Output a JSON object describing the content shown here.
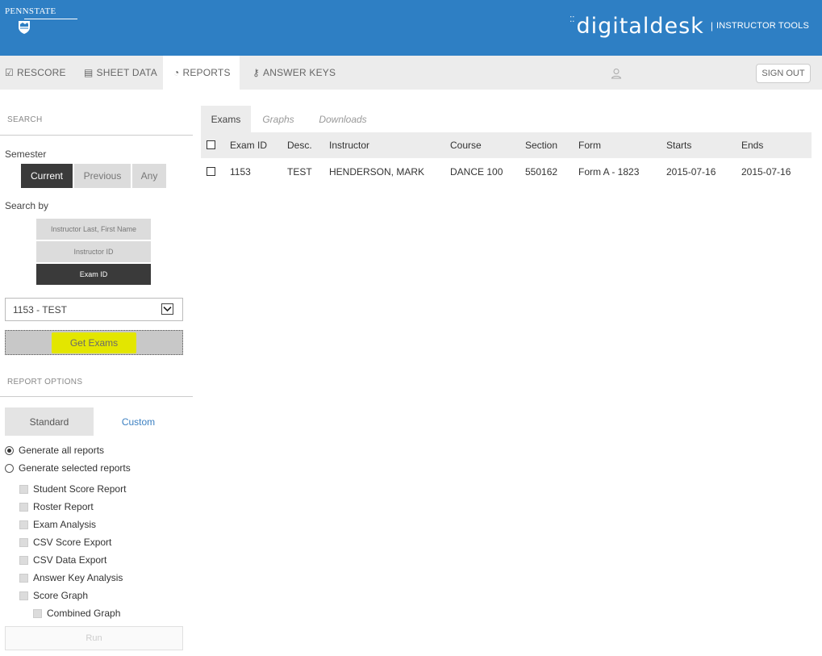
{
  "header": {
    "university": "PENNSTATE",
    "brand_name": "digitaldesk",
    "brand_separator": "|",
    "brand_tools": "INSTRUCTOR TOOLS",
    "color": "#2e7fc4"
  },
  "nav": {
    "items": [
      {
        "label": "RESCORE",
        "icon": "check-square-icon"
      },
      {
        "label": "SHEET DATA",
        "icon": "sheet-icon"
      },
      {
        "label": "REPORTS",
        "icon": "pie-chart-icon",
        "active": true
      },
      {
        "label": "ANSWER KEYS",
        "icon": "key-icon"
      }
    ],
    "signout": "SIGN OUT"
  },
  "sidebar": {
    "search_title": "SEARCH",
    "semester_label": "Semester",
    "semester_options": [
      "Current",
      "Previous",
      "Any"
    ],
    "semester_selected": "Current",
    "search_by_label": "Search by",
    "search_by_options": [
      "Instructor Last, First Name",
      "Instructor ID",
      "Exam ID"
    ],
    "search_by_selected": "Exam ID",
    "exam_select_value": "1153 - TEST",
    "get_exams": "Get Exams",
    "report_options_title": "REPORT OPTIONS",
    "report_tabs": [
      "Standard",
      "Custom"
    ],
    "radios": [
      {
        "label": "Generate all reports",
        "checked": true
      },
      {
        "label": "Generate selected reports",
        "checked": false
      }
    ],
    "reports": [
      "Student Score Report",
      "Roster Report",
      "Exam Analysis",
      "CSV Score Export",
      "CSV Data Export",
      "Answer Key Analysis",
      "Score Graph"
    ],
    "sub_reports": [
      "Combined Graph"
    ],
    "run": "Run"
  },
  "main": {
    "tabs": [
      "Exams",
      "Graphs",
      "Downloads"
    ],
    "active_tab": "Exams",
    "columns": [
      "Exam ID",
      "Desc.",
      "Instructor",
      "Course",
      "Section",
      "Form",
      "Starts",
      "Ends"
    ],
    "rows": [
      [
        "1153",
        "TEST",
        "HENDERSON, MARK",
        "DANCE 100",
        "550162",
        "Form A - 1823",
        "2015-07-16",
        "2015-07-16"
      ]
    ]
  }
}
